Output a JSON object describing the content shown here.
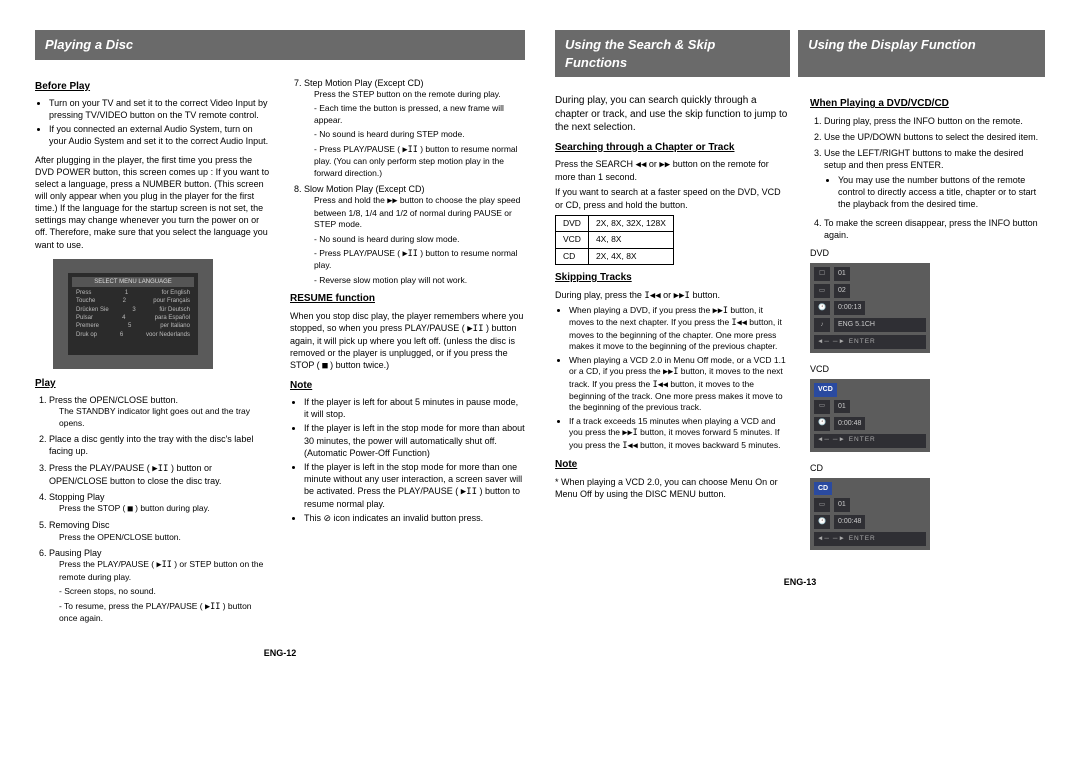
{
  "left": {
    "banner": "Playing a Disc",
    "sub_before": "Before Play",
    "before_bullets": [
      "Turn on your TV and set it to the correct Video Input by pressing TV/VIDEO button on the TV remote control.",
      "If you connected an external Audio System, turn on your Audio System and set it to the correct Audio Input."
    ],
    "lang_para": "After plugging in the player, the first time you press the DVD POWER button, this screen comes up : If you want to select a language, press a NUMBER button. (This screen will only appear when you plug in the player for the first time.) If the language for the startup screen is not set, the settings may change whenever you turn the power on or off. Therefore, make sure that you select the language you want to use.",
    "menu_title": "SELECT MENU LANGUAGE",
    "menu_rows": [
      [
        "Press",
        "1",
        "for English"
      ],
      [
        "Touche",
        "2",
        "pour Français"
      ],
      [
        "Drücken Sie",
        "3",
        "für Deutsch"
      ],
      [
        "Pulsar",
        "4",
        "para Español"
      ],
      [
        "Premere",
        "5",
        "per Italiano"
      ],
      [
        "Druk op",
        "6",
        "voor Nederlands"
      ]
    ],
    "sub_play": "Play",
    "play_1": "Press the OPEN/CLOSE button.",
    "play_1_sub": "The STANDBY indicator light goes out and the tray opens.",
    "play_2": "Place a disc gently into the tray with the disc's label facing up.",
    "play_3a": "Press the PLAY/PAUSE ( ",
    "play_3b": " ) button or OPEN/CLOSE button to close the disc tray.",
    "play_4": "Stopping Play",
    "play_4_sub_a": "Press the STOP ( ",
    "play_4_sub_b": " ) button during play.",
    "play_5": "Removing Disc",
    "play_5_sub": "Press the OPEN/CLOSE button.",
    "play_6": "Pausing Play",
    "play_6_sub_a": "Press the PLAY/PAUSE ( ",
    "play_6_sub_b": " ) or STEP button on the remote during play.",
    "play_6_d1": "- Screen stops, no sound.",
    "play_6_d2a": "- To resume, press the PLAY/PAUSE ( ",
    "play_6_d2b": " ) button once again.",
    "play_7": "Step Motion Play (Except CD)",
    "play_7_sub": "Press the STEP button on the remote during play.",
    "play_7_d1": "- Each time the button is pressed, a new frame will appear.",
    "play_7_d2": "- No sound is heard during STEP mode.",
    "play_7_d3a": "- Press PLAY/PAUSE ( ",
    "play_7_d3b": " ) button to resume normal play. (You can only perform step motion play in the forward direction.)",
    "play_8": "Slow Motion Play (Except CD)",
    "play_8_sub_a": "Press and hold the ",
    "play_8_sub_b": " button to choose the play speed between 1/8, 1/4 and 1/2 of normal during PAUSE or STEP mode.",
    "play_8_d1": "- No sound is heard during slow mode.",
    "play_8_d2a": "- Press PLAY/PAUSE ( ",
    "play_8_d2b": " ) button to resume normal play.",
    "play_8_d3": "- Reverse slow motion play will not work.",
    "sub_resume": "RESUME function",
    "resume_p_a": "When you stop disc play, the player remembers where you stopped, so when you press PLAY/PAUSE ( ",
    "resume_p_b": " ) button again, it will pick up where you left off. (unless the disc is removed or the player is unplugged, or if you press the STOP ( ",
    "resume_p_c": " ) button twice.)",
    "sub_note_l": "Note",
    "note_l_b1": "If the player is left for about 5 minutes in pause mode, it will stop.",
    "note_l_b2": "If the player is left in the stop mode for more than about 30 minutes, the power will automatically shut off. (Automatic Power-Off Function)",
    "note_l_b3_a": "If the player is left in the stop mode for more than one minute without any user interaction, a screen saver will be activated. Press the PLAY/PAUSE ( ",
    "note_l_b3_b": " ) button to resume normal play.",
    "note_l_b4": "This ⊘ icon indicates an invalid button press.",
    "page_num": "ENG-12"
  },
  "right": {
    "banner1": "Using the Search & Skip Functions",
    "banner2": "Using the Display Function",
    "intro": "During play, you can search quickly through a chapter or track, and use the skip function to jump to the next selection.",
    "sub_search": "Searching through a Chapter or Track",
    "search_p_a": "Press the SEARCH ",
    "search_p_b": " or ",
    "search_p_c": " button on the remote for more than 1 second.",
    "search_hold": "If you want to search at a faster speed on the DVD, VCD or CD, press and hold the button.",
    "speed_rows": [
      [
        "DVD",
        "2X, 8X, 32X, 128X"
      ],
      [
        "VCD",
        "4X, 8X"
      ],
      [
        "CD",
        "2X, 4X, 8X"
      ]
    ],
    "sub_skip": "Skipping Tracks",
    "skip_p_a": "During play, press the ",
    "skip_p_b": " or ",
    "skip_p_c": " button.",
    "skip_b1_a": "When playing a DVD, if you press the ",
    "skip_b1_b": " button, it moves to the next chapter. If you press the ",
    "skip_b1_c": " button, it moves to the beginning of the chapter. One more press makes it move to the beginning of the previous chapter.",
    "skip_b2_a": "When playing a VCD 2.0 in Menu Off mode, or a VCD 1.1 or a CD, if you press the ",
    "skip_b2_b": " button, it moves to the next track. If you press the ",
    "skip_b2_c": " button, it moves to the beginning of the track. One more press makes it move to the beginning of the previous track.",
    "skip_b3_a": "If a track exceeds 15 minutes when playing a VCD and you press the ",
    "skip_b3_b": " button, it moves forward 5 minutes. If you press the ",
    "skip_b3_c": " button, it moves backward 5 minutes.",
    "sub_note_r": "Note",
    "note_r": "* When playing a VCD 2.0, you can choose Menu On or Menu Off by using the DISC MENU button.",
    "sub_dvd": "When Playing a DVD/VCD/CD",
    "dvd_1": "During play, press the INFO button on the remote.",
    "dvd_2": "Use the UP/DOWN buttons to select the desired item.",
    "dvd_3": "Use the LEFT/RIGHT buttons to make the desired setup and then press ENTER.",
    "dvd_3_b": "You may use the number buttons of the remote control to directly access a title, chapter or to start the playback from the desired time.",
    "dvd_4": "To make the screen disappear, press the INFO button again.",
    "label_dvd": "DVD",
    "osd_dvd": {
      "r1": "01",
      "r2": "02",
      "r3": "0:00:13",
      "r4": "ENG 5.1CH",
      "bar": "◄─ ─► ENTER"
    },
    "label_vcd": "VCD",
    "osd_vcd": {
      "tag": "VCD",
      "r1": "01",
      "r2": "0:00:48",
      "bar": "◄─ ─► ENTER"
    },
    "label_cd": "CD",
    "osd_cd": {
      "tag": "CD",
      "r1": "01",
      "r2": "0:00:48",
      "bar": "◄─ ─► ENTER"
    },
    "page_num": "ENG-13"
  },
  "glyph": {
    "play_pause": "▶II",
    "stop": "■",
    "fwd": "▶▶",
    "rew": "◀◀",
    "next": "▶▶I",
    "prev": "I◀◀"
  }
}
